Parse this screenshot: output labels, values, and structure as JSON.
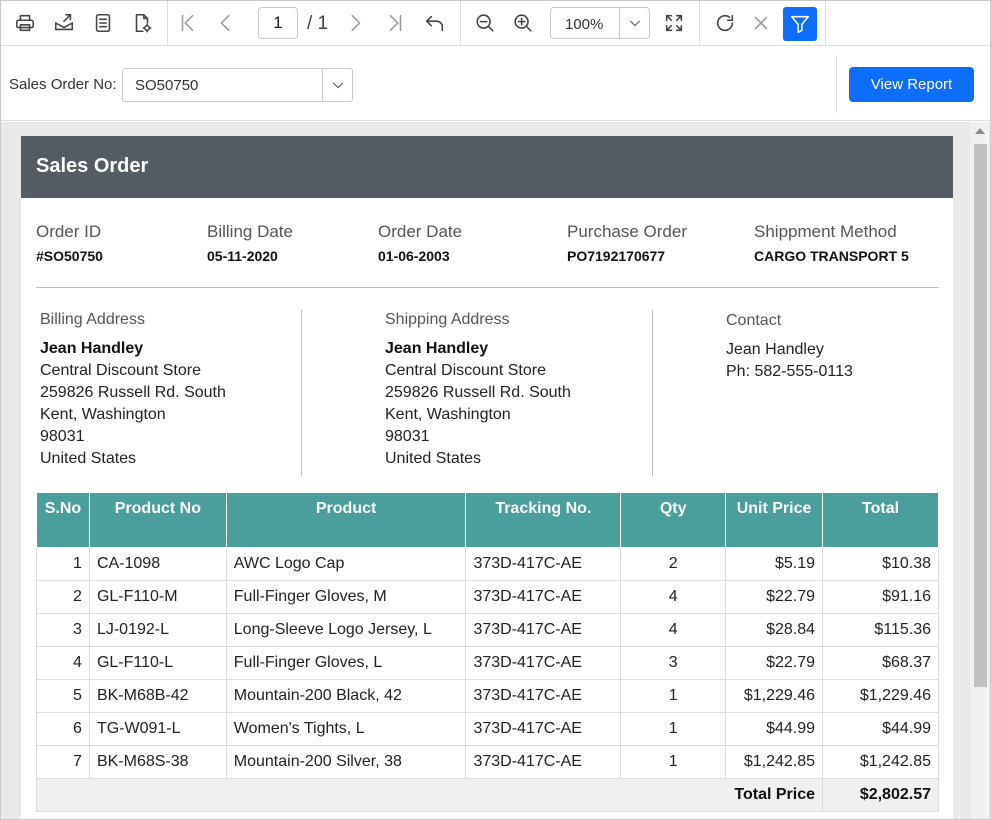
{
  "toolbar": {
    "current_page": "1",
    "total_pages": "/ 1",
    "zoom": "100%"
  },
  "parameters": {
    "label": "Sales Order No:",
    "value": "SO50750",
    "view_button": "View Report"
  },
  "report": {
    "title": "Sales Order",
    "info": [
      {
        "label": "Order ID",
        "value": "#SO50750"
      },
      {
        "label": "Billing Date",
        "value": "05-11-2020"
      },
      {
        "label": "Order Date",
        "value": "01-06-2003"
      },
      {
        "label": "Purchase Order",
        "value": "PO7192170677"
      },
      {
        "label": "Shippment Method",
        "value": "CARGO TRANSPORT 5"
      }
    ],
    "billing": {
      "label": "Billing Address",
      "name": "Jean Handley",
      "company": "Central Discount Store",
      "street": "259826 Russell Rd. South",
      "city": "Kent, Washington",
      "zip": "98031",
      "country": "United States"
    },
    "shipping": {
      "label": "Shipping Address",
      "name": "Jean Handley",
      "company": "Central Discount Store",
      "street": "259826 Russell Rd. South",
      "city": "Kent, Washington",
      "zip": "98031",
      "country": "United States"
    },
    "contact": {
      "label": "Contact",
      "name": "Jean Handley",
      "phone": "Ph: 582-555-0113"
    },
    "table": {
      "headers": [
        "S.No",
        "Product No",
        "Product",
        "Tracking No.",
        "Qty",
        "Unit Price",
        "Total"
      ],
      "rows": [
        [
          "1",
          "CA-1098",
          "AWC Logo Cap",
          "373D-417C-AE",
          "2",
          "$5.19",
          "$10.38"
        ],
        [
          "2",
          "GL-F110-M",
          "Full-Finger Gloves, M",
          "373D-417C-AE",
          "4",
          "$22.79",
          "$91.16"
        ],
        [
          "3",
          "LJ-0192-L",
          "Long-Sleeve Logo Jersey, L",
          "373D-417C-AE",
          "4",
          "$28.84",
          "$115.36"
        ],
        [
          "4",
          "GL-F110-L",
          "Full-Finger Gloves, L",
          "373D-417C-AE",
          "3",
          "$22.79",
          "$68.37"
        ],
        [
          "5",
          "BK-M68B-42",
          "Mountain-200 Black, 42",
          "373D-417C-AE",
          "1",
          "$1,229.46",
          "$1,229.46"
        ],
        [
          "6",
          "TG-W091-L",
          "Women's Tights, L",
          "373D-417C-AE",
          "1",
          "$44.99",
          "$44.99"
        ],
        [
          "7",
          "BK-M68S-38",
          "Mountain-200 Silver, 38",
          "373D-417C-AE",
          "1",
          "$1,242.85",
          "$1,242.85"
        ]
      ],
      "total_label": "Total Price",
      "total_value": "$2,802.57"
    }
  }
}
